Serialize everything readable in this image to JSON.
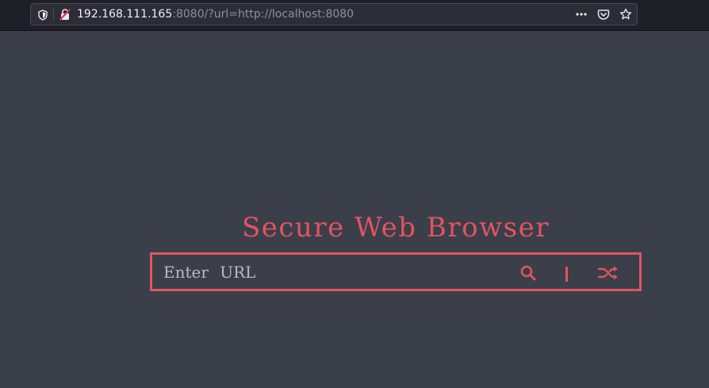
{
  "browser": {
    "url_host": "192.168.111.165",
    "url_rest": ":8080/?url=http://localhost:8080",
    "icons": {
      "tracking": "shield-icon",
      "security": "insecure-lock-icon",
      "more": "more-actions-icon",
      "pocket": "pocket-icon",
      "bookmark": "bookmark-star-icon"
    }
  },
  "page": {
    "title": "Secure Web Browser",
    "search": {
      "placeholder": "Enter URL",
      "value": ""
    },
    "icons": {
      "search": "search-icon",
      "random": "shuffle-icon"
    },
    "colors": {
      "accent": "#e2545f",
      "background": "#3a3f4a"
    }
  }
}
